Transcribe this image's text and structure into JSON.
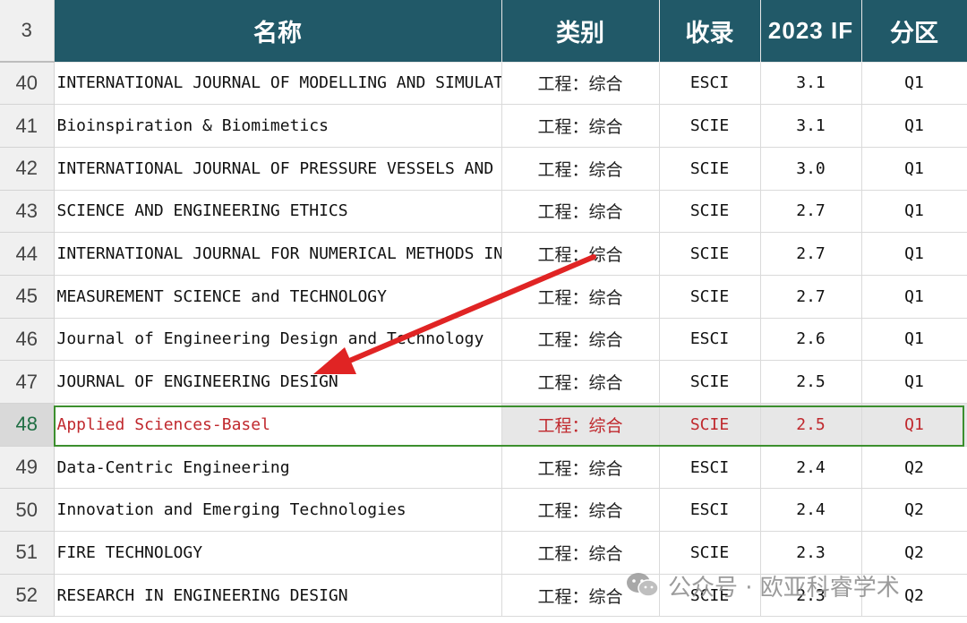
{
  "header": {
    "row_number": "3",
    "name": "名称",
    "category": "类别",
    "index": "收录",
    "if_year": "2023 IF",
    "zone": "分区"
  },
  "rows": [
    {
      "num": "40",
      "name": "INTERNATIONAL JOURNAL OF MODELLING AND SIMULATION",
      "category": "工程：综合",
      "index": "ESCI",
      "if": "3.1",
      "zone": "Q1"
    },
    {
      "num": "41",
      "name": "Bioinspiration & Biomimetics",
      "category": "工程：综合",
      "index": "SCIE",
      "if": "3.1",
      "zone": "Q1"
    },
    {
      "num": "42",
      "name": "INTERNATIONAL JOURNAL OF PRESSURE VESSELS AND PIPING",
      "category": "工程：综合",
      "index": "SCIE",
      "if": "3.0",
      "zone": "Q1"
    },
    {
      "num": "43",
      "name": "SCIENCE AND ENGINEERING ETHICS",
      "category": "工程：综合",
      "index": "SCIE",
      "if": "2.7",
      "zone": "Q1"
    },
    {
      "num": "44",
      "name": "INTERNATIONAL JOURNAL FOR NUMERICAL METHODS IN ENGINEERING",
      "category": "工程：综合",
      "index": "SCIE",
      "if": "2.7",
      "zone": "Q1"
    },
    {
      "num": "45",
      "name": "MEASUREMENT SCIENCE and TECHNOLOGY",
      "category": "工程：综合",
      "index": "SCIE",
      "if": "2.7",
      "zone": "Q1"
    },
    {
      "num": "46",
      "name": "Journal of Engineering Design and Technology",
      "category": "工程：综合",
      "index": "ESCI",
      "if": "2.6",
      "zone": "Q1"
    },
    {
      "num": "47",
      "name": "JOURNAL OF ENGINEERING DESIGN",
      "category": "工程：综合",
      "index": "SCIE",
      "if": "2.5",
      "zone": "Q1"
    },
    {
      "num": "48",
      "name": "Applied Sciences-Basel",
      "category": "工程：综合",
      "index": "SCIE",
      "if": "2.5",
      "zone": "Q1"
    },
    {
      "num": "49",
      "name": "Data-Centric Engineering",
      "category": "工程：综合",
      "index": "ESCI",
      "if": "2.4",
      "zone": "Q2"
    },
    {
      "num": "50",
      "name": "Innovation and Emerging Technologies",
      "category": "工程：综合",
      "index": "ESCI",
      "if": "2.4",
      "zone": "Q2"
    },
    {
      "num": "51",
      "name": "FIRE TECHNOLOGY",
      "category": "工程：综合",
      "index": "SCIE",
      "if": "2.3",
      "zone": "Q2"
    },
    {
      "num": "52",
      "name": "RESEARCH IN ENGINEERING DESIGN",
      "category": "工程：综合",
      "index": "SCIE",
      "if": "2.3",
      "zone": "Q2"
    }
  ],
  "selected_row": "48",
  "watermark": {
    "icon": "wechat-icon",
    "text": "公众号 · 欧亚科睿学术"
  },
  "colors": {
    "header_bg": "#215968",
    "selected_text": "#c0282d",
    "selection_border": "#3c8f2e",
    "arrow": "#e02424"
  }
}
